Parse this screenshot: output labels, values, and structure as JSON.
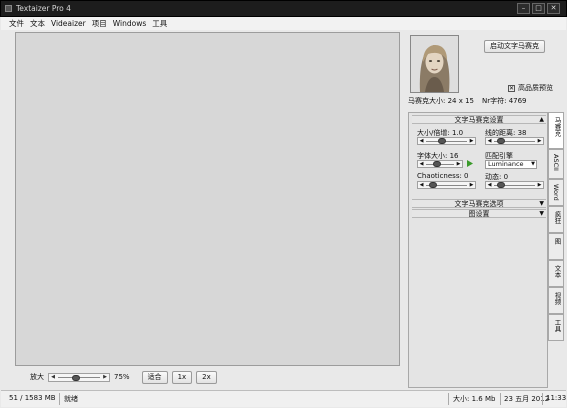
{
  "window": {
    "title": "Textaizer Pro 4",
    "buttons": [
      "–",
      "□",
      "✕"
    ]
  },
  "menu": [
    "文件",
    "文本",
    "Videaizer",
    "项目",
    "Windows",
    "工具"
  ],
  "zoom": {
    "label": "放大",
    "value": "75%",
    "fraction": 0.42,
    "buttons": [
      "适合",
      "1x",
      "2x"
    ]
  },
  "status": {
    "memory": "51 / 1583 MB",
    "state": "就绪",
    "size": "大小: 1.6 Mb",
    "date": "23 五月 2012",
    "time": "11:33"
  },
  "side": {
    "start_button": "启动文字马赛克",
    "hq_label": "高品质预览",
    "hq_checked": true,
    "mosaic_size": "马赛克大小: 24 x 15",
    "char_count": "Nr字符: 4769",
    "section_settings": "文字马赛克设置",
    "section_options": "文字马赛克选项",
    "section_image": "图设置",
    "params": {
      "smooth": {
        "label": "大小/倍增: 1.0",
        "fraction": 0.35
      },
      "line_dist": {
        "label": "线的距离: 38",
        "fraction": 0.1
      },
      "font_size": {
        "label": "字体大小: 16",
        "fraction": 0.35
      },
      "match": {
        "label": "匹配引擎",
        "value": "Luminance"
      },
      "chaoticness": {
        "label": "Chaoticness: 0",
        "fraction": 0.1
      },
      "dynamic": {
        "label": "动态: 0",
        "fraction": 0.1
      }
    },
    "tabs": [
      "马赛克",
      "ASCII",
      "Word",
      "疯狂",
      "图",
      "文本",
      "视频",
      "工具"
    ]
  }
}
